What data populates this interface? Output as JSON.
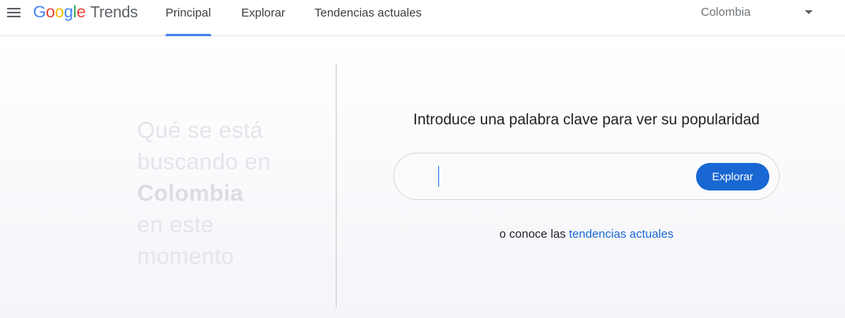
{
  "header": {
    "logo": {
      "google_letters": [
        {
          "char": "G",
          "color": "#4285f4"
        },
        {
          "char": "o",
          "color": "#ea4335"
        },
        {
          "char": "o",
          "color": "#fbbc05"
        },
        {
          "char": "g",
          "color": "#4285f4"
        },
        {
          "char": "l",
          "color": "#34a853"
        },
        {
          "char": "e",
          "color": "#ea4335"
        }
      ],
      "product": "Trends"
    },
    "menu_icon": "hamburger-menu-icon",
    "tabs": [
      {
        "label": "Principal",
        "active": true
      },
      {
        "label": "Explorar",
        "active": false
      },
      {
        "label": "Tendencias actuales",
        "active": false
      }
    ],
    "country": {
      "selected": "Colombia",
      "icon": "caret-down-icon"
    },
    "accent_color": "#4a86e8"
  },
  "main": {
    "tagline": {
      "line1": "Qué se está",
      "line2": "buscando en",
      "country": "Colombia",
      "line4": "en este",
      "line5": "momento"
    },
    "prompt": "Introduce una palabra clave para ver su popularidad",
    "search": {
      "value": "",
      "placeholder": "",
      "button_label": "Explorar",
      "button_color": "#1967d2"
    },
    "hint": {
      "prefix": "o conoce las",
      "link": "tendencias actuales",
      "link_color": "#1967d2"
    }
  }
}
